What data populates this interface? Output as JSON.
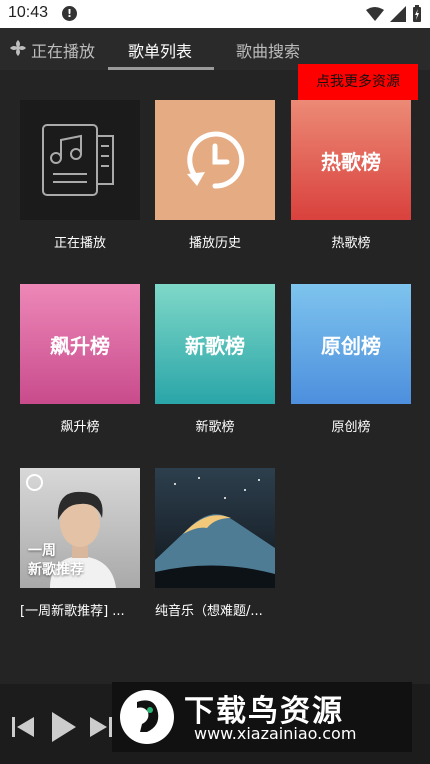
{
  "status_bar": {
    "time": "10:43"
  },
  "tabs": [
    {
      "label": "正在播放"
    },
    {
      "label": "歌单列表"
    },
    {
      "label": "歌曲搜索"
    }
  ],
  "promo": {
    "label": "点我更多资源"
  },
  "cards": [
    {
      "caption": "正在播放"
    },
    {
      "caption": "播放历史"
    },
    {
      "title": "热歌榜",
      "caption": "热歌榜"
    },
    {
      "title": "飙升榜",
      "caption": "飙升榜"
    },
    {
      "title": "新歌榜",
      "caption": "新歌榜"
    },
    {
      "title": "原创榜",
      "caption": "原创榜"
    },
    {
      "overlay_line1": "一周",
      "overlay_line2": "新歌推荐",
      "caption": "[一周新歌推荐] ..."
    },
    {
      "caption": "纯音乐（想难题/..."
    }
  ],
  "watermark": {
    "title": "下载鸟资源",
    "url": "www.xiazainiao.com"
  },
  "colors": {
    "promo": "#ff0000",
    "hot": "#e4594f",
    "rise": "#d85c98",
    "new": "#37b7aa",
    "original": "#5aa7e6"
  }
}
